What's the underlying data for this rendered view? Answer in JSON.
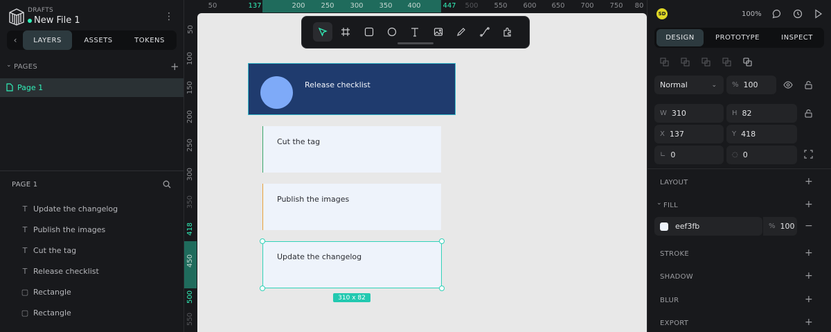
{
  "file": {
    "section": "DRAFTS",
    "name": "New File 1"
  },
  "left_tabs": {
    "layers": "LAYERS",
    "assets": "ASSETS",
    "tokens": "TOKENS"
  },
  "pages": {
    "title": "PAGES",
    "items": [
      "Page 1"
    ]
  },
  "layers_panel": {
    "title": "PAGE 1",
    "items": [
      {
        "icon": "text-icon",
        "label": "Update the changelog"
      },
      {
        "icon": "text-icon",
        "label": "Publish the images"
      },
      {
        "icon": "text-icon",
        "label": "Cut the tag"
      },
      {
        "icon": "text-icon",
        "label": "Release checklist"
      },
      {
        "icon": "rectangle-icon",
        "label": "Rectangle"
      },
      {
        "icon": "rectangle-icon",
        "label": "Rectangle"
      }
    ]
  },
  "ruler": {
    "h_ticks": [
      "50",
      "137",
      "200",
      "250",
      "300",
      "350",
      "400",
      "447",
      "500",
      "550",
      "600",
      "650",
      "700",
      "750",
      "80"
    ],
    "v_ticks": [
      "50",
      "100",
      "150",
      "200",
      "250",
      "300",
      "350",
      "418",
      "450",
      "500",
      "550"
    ]
  },
  "canvas": {
    "header_title": "Release checklist",
    "cards": [
      "Cut the tag",
      "Publish the images",
      "Update the changelog"
    ],
    "size_badge": "310 x 82",
    "colors": {
      "header_bg": "#1f3b6e",
      "circle": "#7eaaf8",
      "card_bg": "#eef3fb",
      "accent_green": "#3aa66b",
      "accent_orange": "#e8a13b",
      "selection": "#31d2b8"
    }
  },
  "right": {
    "avatar": "SD",
    "zoom": "100%",
    "tabs": {
      "design": "DESIGN",
      "prototype": "PROTOTYPE",
      "inspect": "INSPECT"
    },
    "blend": "Normal",
    "opacity_unit": "%",
    "opacity": "100",
    "w_label": "W",
    "w": "310",
    "h_label": "H",
    "h": "82",
    "x_label": "X",
    "x": "137",
    "y_label": "Y",
    "y": "418",
    "rotation": "0",
    "radius": "0",
    "sections": {
      "layout": "LAYOUT",
      "fill": "FILL",
      "stroke": "STROKE",
      "shadow": "SHADOW",
      "blur": "BLUR",
      "export": "EXPORT"
    },
    "fill": {
      "hex": "eef3fb",
      "unit": "%",
      "opacity": "100"
    }
  }
}
